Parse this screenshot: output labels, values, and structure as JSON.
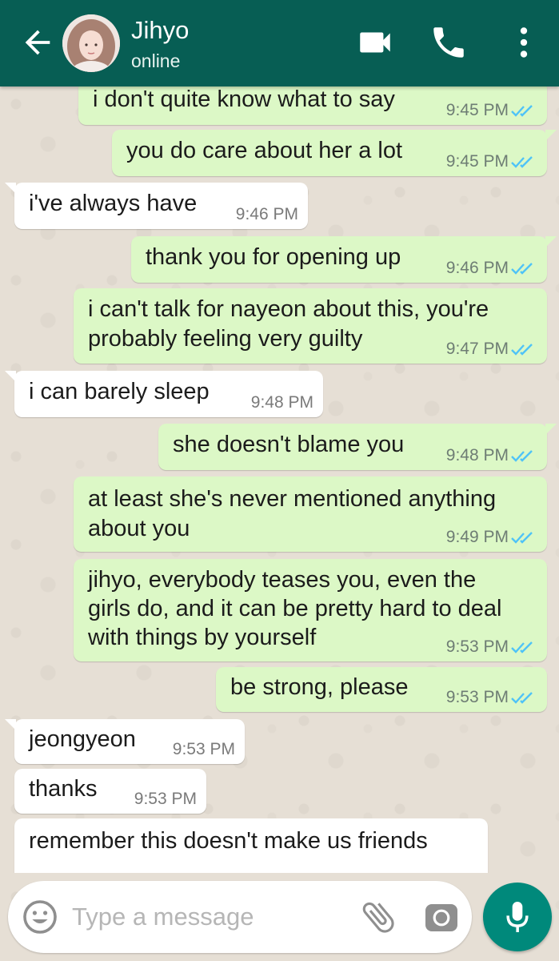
{
  "header": {
    "contact_name": "Jihyo",
    "status": "online",
    "icons": {
      "back": "arrow-back-icon",
      "video": "video-camera-icon",
      "call": "phone-icon",
      "menu": "more-vert-icon"
    },
    "color": "#075e54"
  },
  "messages": [
    {
      "direction": "outgoing",
      "text": "i don't quite know what to say",
      "time": "9:45 PM",
      "read": true
    },
    {
      "direction": "outgoing",
      "text": "you do care about her a lot",
      "time": "9:45 PM",
      "read": true
    },
    {
      "direction": "incoming",
      "text": "i've always have",
      "time": "9:46 PM"
    },
    {
      "direction": "outgoing",
      "text": "thank you for opening up",
      "time": "9:46 PM",
      "read": true
    },
    {
      "direction": "outgoing",
      "lines": [
        "i can't talk for nayeon about this, you're",
        "probably feeling very guilty"
      ],
      "time": "9:47 PM",
      "read": true
    },
    {
      "direction": "incoming",
      "text": "i can barely sleep",
      "time": "9:48 PM"
    },
    {
      "direction": "outgoing",
      "text": "she doesn't blame you",
      "time": "9:48 PM",
      "read": true
    },
    {
      "direction": "outgoing",
      "lines": [
        "at least she's never mentioned anything",
        "about you"
      ],
      "time": "9:49 PM",
      "read": true
    },
    {
      "direction": "outgoing",
      "lines": [
        "jihyo, everybody teases you, even the",
        "girls do, and it can be pretty hard to deal",
        "with things by yourself"
      ],
      "time": "9:53 PM",
      "read": true
    },
    {
      "direction": "outgoing",
      "text": "be strong, please",
      "time": "9:53 PM",
      "read": true
    },
    {
      "direction": "incoming",
      "text": "jeongyeon",
      "time": "9:53 PM"
    },
    {
      "direction": "incoming",
      "text": "thanks",
      "time": "9:53 PM"
    },
    {
      "direction": "incoming",
      "text": "remember this doesn't make us friends",
      "time": ""
    }
  ],
  "composer": {
    "placeholder": "Type a message",
    "value": "",
    "icons": {
      "emoji": "emoji-icon",
      "attach": "paperclip-icon",
      "camera": "camera-icon",
      "mic": "microphone-icon"
    },
    "accent": "#00897b"
  },
  "colors": {
    "outgoing_bubble": "#dcf8c6",
    "incoming_bubble": "#ffffff",
    "read_ticks": "#4fc3f7"
  }
}
